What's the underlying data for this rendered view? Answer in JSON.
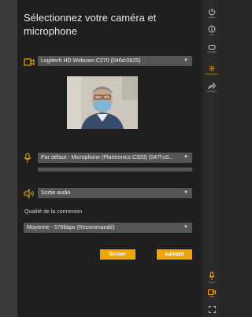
{
  "dialog": {
    "title": "Sélectionnez votre caméra et microphone",
    "camera_select": "Logitech HD Webcam C270 (046d:0825)",
    "microphone_select": "Par défaut - Microphone (Plantronics C320) (047f:c0...",
    "audio_output_select": "Sortie audio",
    "quality_label": "Qualité de la connexion",
    "quality_select": "Moyenne - 576kbps (Recommandé)",
    "close_button": "fermer",
    "next_button": "suivant"
  },
  "sidebar": {
    "items": [
      {
        "caption": "Quitter",
        "icon": "power-icon"
      },
      {
        "caption": "Info",
        "icon": "info-icon"
      },
      {
        "caption": "Contrôle",
        "icon": "gamepad-icon"
      },
      {
        "caption": "Participants",
        "icon": "people-icon"
      },
      {
        "caption": "Paramètres",
        "icon": "gear-icon"
      },
      {
        "caption": "Partager",
        "icon": "share-icon"
      }
    ],
    "bottom_items": [
      {
        "caption": "Micro",
        "icon": "mic-icon"
      },
      {
        "caption": "Vidéo",
        "icon": "video-icon"
      },
      {
        "caption": "",
        "icon": "fullscreen-icon"
      }
    ]
  },
  "colors": {
    "accent": "#f0a500",
    "panel": "#1f1f1f",
    "select": "#555555"
  }
}
